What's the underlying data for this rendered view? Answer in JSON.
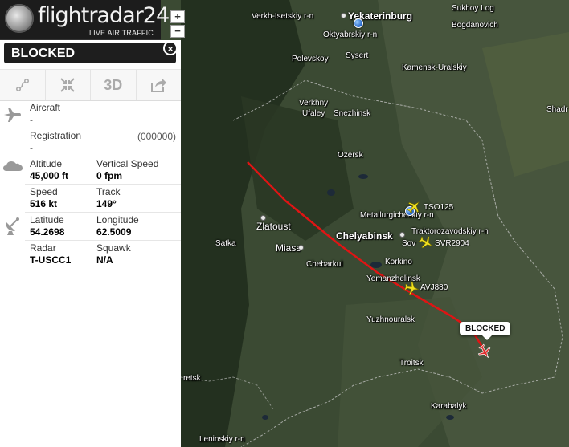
{
  "app": {
    "logo_text": "flightradar24",
    "logo_tagline": "LIVE AIR TRAFFIC",
    "zoom_in": "+",
    "zoom_out": "−"
  },
  "panel": {
    "title": "BLOCKED",
    "close_label": "×",
    "toolbar": [
      {
        "icon": "route-icon",
        "label": ""
      },
      {
        "icon": "collapse-arrows-icon",
        "label": ""
      },
      {
        "icon": "3d-view",
        "label": "3D"
      },
      {
        "icon": "share-icon",
        "label": ""
      }
    ],
    "aircraft": {
      "label": "Aircraft",
      "value": "-"
    },
    "registration": {
      "label": "Registration",
      "value": "-",
      "code": "(000000)"
    },
    "altitude": {
      "label": "Altitude",
      "value": "45,000 ft"
    },
    "vertical_speed": {
      "label": "Vertical Speed",
      "value": "0 fpm"
    },
    "speed": {
      "label": "Speed",
      "value": "516 kt"
    },
    "track": {
      "label": "Track",
      "value": "149°"
    },
    "latitude": {
      "label": "Latitude",
      "value": "54.2698"
    },
    "longitude": {
      "label": "Longitude",
      "value": "62.5009"
    },
    "radar": {
      "label": "Radar",
      "value": "T-USCC1"
    },
    "squawk": {
      "label": "Squawk",
      "value": "N/A"
    }
  },
  "map": {
    "places": {
      "yekaterinburg": "Yekaterinburg",
      "verkh_isetskiy": "Verkh-Isetskiy r-n",
      "oktyabrskiy": "Oktyabrskiy r-n",
      "sukhoy_log": "Sukhoy Log",
      "bogdanovich": "Bogdanovich",
      "polevskoy": "Polevskoy",
      "sysert": "Sysert",
      "kamensk": "Kamensk-Uralskiy",
      "verkhny": "Verkhny",
      "ufaley": "Ufaley",
      "snezhinsk": "Snezhinsk",
      "shadr": "Shadr",
      "ozersk": "Ozersk",
      "metallurgicheskiy": "Metallurgicheskiy r-n",
      "zlatoust": "Zlatoust",
      "chelyabinsk": "Chelyabinsk",
      "traktorozavodskiy": "Traktorozavodskiy r-n",
      "sov": "Sov",
      "satka": "Satka",
      "miass": "Miass",
      "chebarkul": "Chebarkul",
      "korkino": "Korkino",
      "yemanzhelinsk": "Yemanzhelinsk",
      "yuzhnouralsk": "Yuzhnouralsk",
      "troitsk": "Troitsk",
      "karabalyk": "Karabalyk",
      "retsk": "retsk",
      "leninskiy": "Leninskiy r-n"
    },
    "flights": [
      {
        "callsign": "TSO125"
      },
      {
        "callsign": "SVR2904"
      },
      {
        "callsign": "AVJ880"
      }
    ],
    "selected_flight_tag": "BLOCKED",
    "colors": {
      "track": "#e01414",
      "selected_plane": "#e03030",
      "other_planes": "#f0e020"
    }
  }
}
